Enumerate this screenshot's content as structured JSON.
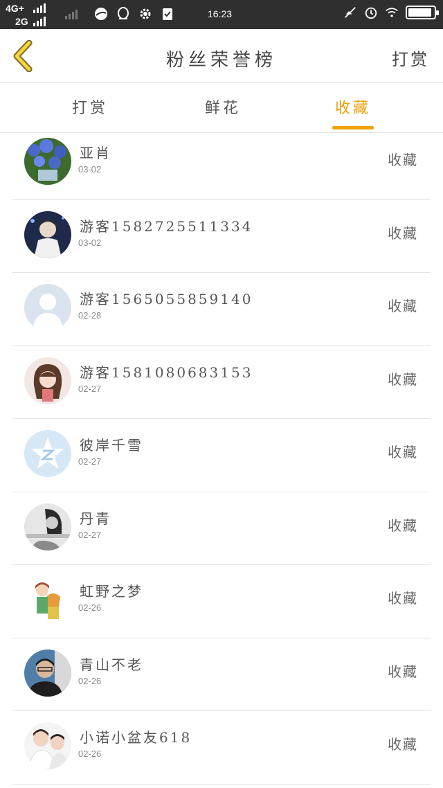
{
  "status_bar": {
    "network_top": "4G+",
    "network_bottom": "2G",
    "time": "16:23",
    "battery_level": 0.92
  },
  "header": {
    "title": "粉丝荣誉榜",
    "action": "打赏"
  },
  "tabs": [
    {
      "label": "打赏",
      "active": false
    },
    {
      "label": "鲜花",
      "active": false
    },
    {
      "label": "收藏",
      "active": true
    }
  ],
  "colors": {
    "accent": "#f0a30a",
    "status_bar": "#2f2f2f"
  },
  "fans": [
    {
      "name": "亚肖",
      "date": "03-02",
      "action": "收藏",
      "avatar": "flowers-avatar"
    },
    {
      "name": "游客1582725511334",
      "date": "03-02",
      "action": "收藏",
      "avatar": "anime-boy-avatar"
    },
    {
      "name": "游客1565055859140",
      "date": "02-28",
      "action": "收藏",
      "avatar": "default-person-avatar"
    },
    {
      "name": "游客1581080683153",
      "date": "02-27",
      "action": "收藏",
      "avatar": "anime-girl-avatar"
    },
    {
      "name": "彼岸千雪",
      "date": "02-27",
      "action": "收藏",
      "avatar": "qzone-star-avatar"
    },
    {
      "name": "丹青",
      "date": "02-27",
      "action": "收藏",
      "avatar": "grayscale-girl-avatar"
    },
    {
      "name": "虹野之梦",
      "date": "02-26",
      "action": "收藏",
      "avatar": "cartoon-couple-avatar"
    },
    {
      "name": "青山不老",
      "date": "02-26",
      "action": "收藏",
      "avatar": "man-photo-avatar"
    },
    {
      "name": "小诺小盆友618",
      "date": "02-26",
      "action": "收藏",
      "avatar": "boys-photo-avatar"
    }
  ]
}
